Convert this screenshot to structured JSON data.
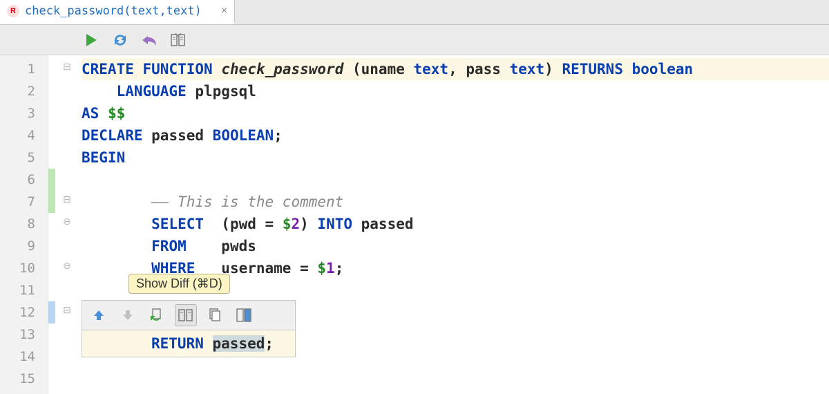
{
  "tab": {
    "icon_letter": "R",
    "label": "check_password(text,text)",
    "close": "×"
  },
  "toolbar": {
    "run": "run-icon",
    "refresh": "refresh-icon",
    "revert": "revert-icon",
    "diff": "diff-icon"
  },
  "gutter": [
    "1",
    "2",
    "3",
    "4",
    "5",
    "6",
    "7",
    "8",
    "9",
    "10",
    "11",
    "12",
    "13",
    "14",
    "15"
  ],
  "code": {
    "l1": {
      "kw1": "CREATE",
      "kw2": "FUNCTION",
      "fn": "check_password",
      "open": " (uname ",
      "t1": "text",
      "comma": ", pass ",
      "t2": "text",
      "close": ") ",
      "kw3": "RETURNS",
      "sp": " ",
      "kw4": "boolean"
    },
    "l2": {
      "indent": "    ",
      "kw": "LANGUAGE",
      "rest": " plpgsql"
    },
    "l3": {
      "kw": "AS",
      "sp": " ",
      "dd": "$$"
    },
    "l4": {
      "kw": "DECLARE",
      "mid": " passed ",
      "kw2": "BOOLEAN",
      "semi": ";"
    },
    "l5": {
      "kw": "BEGIN"
    },
    "l7": {
      "indent": "        ",
      "dash": "—— ",
      "txt": "This is the comment"
    },
    "l8": {
      "indent": "        ",
      "kw": "SELECT",
      "spc": "  (pwd = ",
      "p": "$",
      "n": "2",
      "close": ") ",
      "kw2": "INTO",
      "rest": " passed"
    },
    "l9": {
      "indent": "        ",
      "kw": "FROM",
      "rest": "    pwds"
    },
    "l10": {
      "indent": "        ",
      "kw": "WHERE",
      "mid": "   username = ",
      "p": "$",
      "n": "1",
      "semi": ";"
    }
  },
  "hunk": {
    "tooltip": "Show Diff (⌘D)",
    "line": {
      "kw": "RETURN",
      "sp": " ",
      "sel": "passed",
      "semi": ";"
    }
  }
}
